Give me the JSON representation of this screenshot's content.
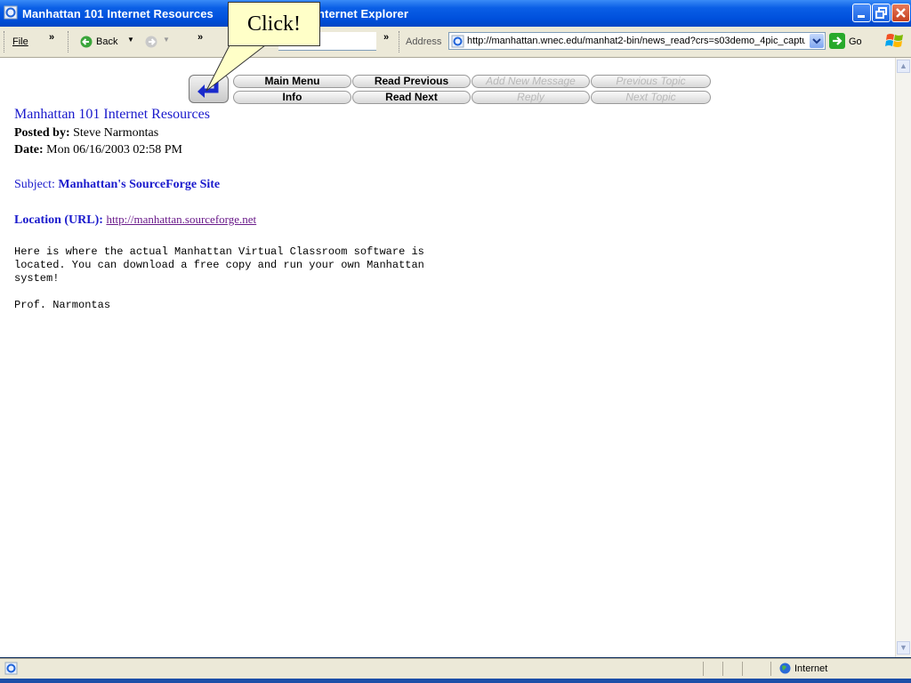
{
  "window": {
    "title": "Manhattan 101 Internet Resources - Microsoft Internet Explorer",
    "title_visible_left": "Manhattan 101 Internet Resources",
    "title_visible_right": "nternet Explorer"
  },
  "toolbar": {
    "file_menu": "File",
    "back_label": "Back",
    "address_label": "Address",
    "address_url": "http://manhattan.wnec.edu/manhat2-bin/news_read?crs=s03demo_4pic_captur",
    "go_label": "Go"
  },
  "callout": {
    "text": "Click!"
  },
  "nav": {
    "main_menu": "Main Menu",
    "info": "Info",
    "read_previous": "Read Previous",
    "read_next": "Read Next",
    "add_new_message": "Add New Message",
    "reply": "Reply",
    "previous_topic": "Previous Topic",
    "next_topic": "Next Topic"
  },
  "message": {
    "title": "Manhattan 101 Internet Resources",
    "posted_by_label": "Posted by:",
    "posted_by": "Steve Narmontas",
    "date_label": "Date:",
    "date": "Mon 06/16/2003 02:58 PM",
    "subject_label": "Subject:",
    "subject": "Manhattan's SourceForge Site",
    "location_label": "Location (URL):",
    "location_url": "http://manhattan.sourceforge.net",
    "body": "Here is where the actual Manhattan Virtual Classroom software is\nlocated. You can download a free copy and run your own Manhattan\nsystem!\n\nProf. Narmontas"
  },
  "status": {
    "zone": "Internet"
  },
  "colors": {
    "titlebar": "#0050dc",
    "link": "#1a1acc",
    "visited_link": "#6a1a8a",
    "callout": "#ffffc8"
  }
}
